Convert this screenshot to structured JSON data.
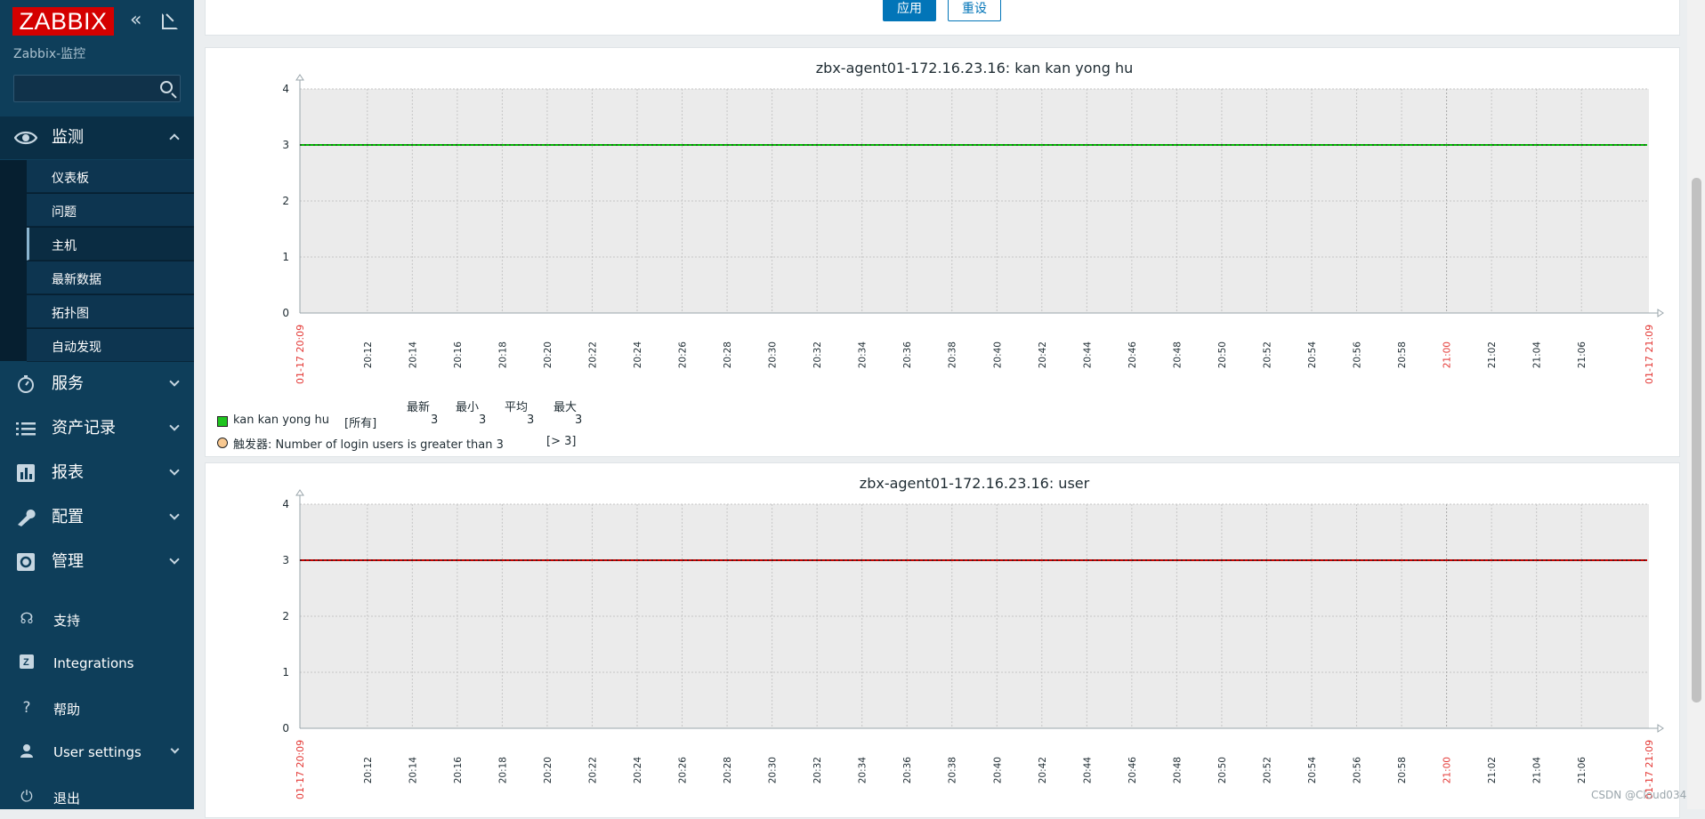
{
  "sidebar": {
    "logo": "ZABBIX",
    "server_name": "Zabbix-监控",
    "search_placeholder": "",
    "main_menu": [
      {
        "label": "监测",
        "icon": "eye-icon",
        "open": true
      },
      {
        "label": "服务",
        "icon": "stopwatch-icon"
      },
      {
        "label": "资产记录",
        "icon": "list-icon"
      },
      {
        "label": "报表",
        "icon": "bar-chart-icon"
      },
      {
        "label": "配置",
        "icon": "wrench-icon"
      },
      {
        "label": "管理",
        "icon": "gear-icon"
      }
    ],
    "submenu": [
      {
        "label": "仪表板"
      },
      {
        "label": "问题"
      },
      {
        "label": "主机",
        "active": true
      },
      {
        "label": "最新数据"
      },
      {
        "label": "拓扑图"
      },
      {
        "label": "自动发现"
      }
    ],
    "footer_menu": [
      {
        "label": "支持",
        "icon": "headset-icon"
      },
      {
        "label": "Integrations",
        "icon": "integrations-icon"
      },
      {
        "label": "帮助",
        "icon": "help-icon"
      },
      {
        "label": "User settings",
        "icon": "user-icon"
      },
      {
        "label": "退出",
        "icon": "power-icon"
      }
    ]
  },
  "filter": {
    "apply_label": "应用",
    "reset_label": "重设"
  },
  "chart_data": [
    {
      "type": "line",
      "title": "zbx-agent01-172.16.23.16: kan kan yong hu",
      "ylim": [
        0,
        4
      ],
      "y_ticks": [
        "4",
        "3",
        "2",
        "1",
        "0"
      ],
      "x_start_label": "01-17 20:09",
      "x_end_label": "01-17 21:09",
      "x_ticks": [
        "20:12",
        "20:14",
        "20:16",
        "20:18",
        "20:20",
        "20:22",
        "20:24",
        "20:26",
        "20:28",
        "20:30",
        "20:32",
        "20:34",
        "20:36",
        "20:38",
        "20:40",
        "20:42",
        "20:44",
        "20:46",
        "20:48",
        "20:50",
        "20:52",
        "20:54",
        "20:56",
        "20:58",
        "21:00",
        "21:02",
        "21:04",
        "21:06"
      ],
      "highlight_tick": "21:00",
      "grid": true,
      "series": [
        {
          "name": "kan kan yong hu",
          "color": "#00c000",
          "values": [
            3,
            3
          ]
        }
      ],
      "trigger": {
        "value": 3,
        "color": "#f8c880"
      },
      "legend": {
        "headers": [
          "最新",
          "最小",
          "平均",
          "最大"
        ],
        "rows": [
          {
            "name": "kan kan yong hu",
            "func": "[所有]",
            "values": [
              "3",
              "3",
              "3",
              "3"
            ],
            "color": "#1fc41f"
          }
        ],
        "trigger_label": "触发器: Number of login users is greater than 3",
        "trigger_cond": "[> 3]",
        "trigger_color": "#f8c890"
      }
    },
    {
      "type": "line",
      "title": "zbx-agent01-172.16.23.16: user",
      "ylim": [
        0,
        4
      ],
      "y_ticks": [
        "4",
        "3",
        "2",
        "1",
        "0"
      ],
      "x_start_label": "01-17 20:09",
      "x_end_label": "01-17 21:09",
      "x_ticks": [
        "20:12",
        "20:14",
        "20:16",
        "20:18",
        "20:20",
        "20:22",
        "20:24",
        "20:26",
        "20:28",
        "20:30",
        "20:32",
        "20:34",
        "20:36",
        "20:38",
        "20:40",
        "20:42",
        "20:44",
        "20:46",
        "20:48",
        "20:50",
        "20:52",
        "20:54",
        "20:56",
        "20:58",
        "21:00",
        "21:02",
        "21:04",
        "21:06"
      ],
      "highlight_tick": "21:00",
      "grid": true,
      "series": [
        {
          "name": "",
          "color": "#c80000",
          "values": [
            3,
            3
          ]
        }
      ],
      "trigger": null,
      "legend": null
    }
  ],
  "watermark": "CSDN @Cloud034"
}
